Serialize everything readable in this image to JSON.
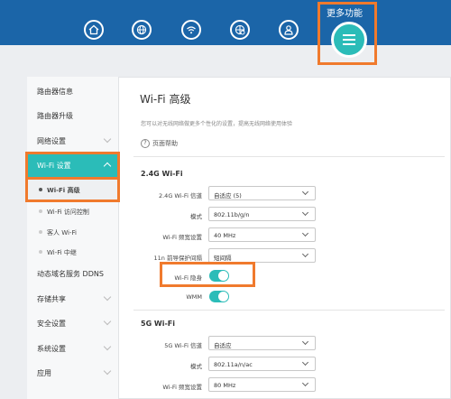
{
  "header": {
    "icons": [
      "home-icon",
      "globe-icon",
      "wifi-icon",
      "network-icon",
      "user-icon"
    ],
    "more_label": "更多功能",
    "more_icon": "menu-icon"
  },
  "sidebar": {
    "items": [
      {
        "label": "路由器信息"
      },
      {
        "label": "路由器升级"
      },
      {
        "label": "网络设置"
      },
      {
        "label": "Wi-Fi 设置"
      },
      {
        "label": "动态域名服务 DDNS"
      },
      {
        "label": "存储共享"
      },
      {
        "label": "安全设置"
      },
      {
        "label": "系统设置"
      },
      {
        "label": "应用"
      }
    ],
    "wifi_sub": [
      {
        "label": "Wi-Fi 高级"
      },
      {
        "label": "Wi-Fi 访问控制"
      },
      {
        "label": "客人 Wi-Fi"
      },
      {
        "label": "Wi-Fi 中继"
      }
    ]
  },
  "content": {
    "title": "Wi-Fi 高级",
    "description": "您可以对无线网络做更多个性化的设置，提高无线网络使用体验",
    "help": "页面帮助",
    "section_24g": "2.4G Wi-Fi",
    "fields_24g": [
      {
        "label": "2.4G Wi-Fi 信道",
        "value": "自适应 (5)"
      },
      {
        "label": "模式",
        "value": "802.11b/g/n"
      },
      {
        "label": "Wi-Fi 频宽设置",
        "value": "40 MHz"
      },
      {
        "label": "11n 前导保护间隔",
        "value": "短间隔"
      }
    ],
    "hide_label": "Wi-Fi 隐身",
    "hide_state": "on",
    "wmm_label": "WMM",
    "wmm_state": "on",
    "section_5g": "5G Wi-Fi",
    "fields_5g": [
      {
        "label": "5G Wi-Fi 信道",
        "value": "自适应"
      },
      {
        "label": "模式",
        "value": "802.11a/n/ac"
      },
      {
        "label": "Wi-Fi 频宽设置",
        "value": "80 MHz"
      }
    ]
  },
  "colors": {
    "header": "#1b65a8",
    "accent": "#2bbcb8",
    "highlight": "#f07a2d"
  }
}
